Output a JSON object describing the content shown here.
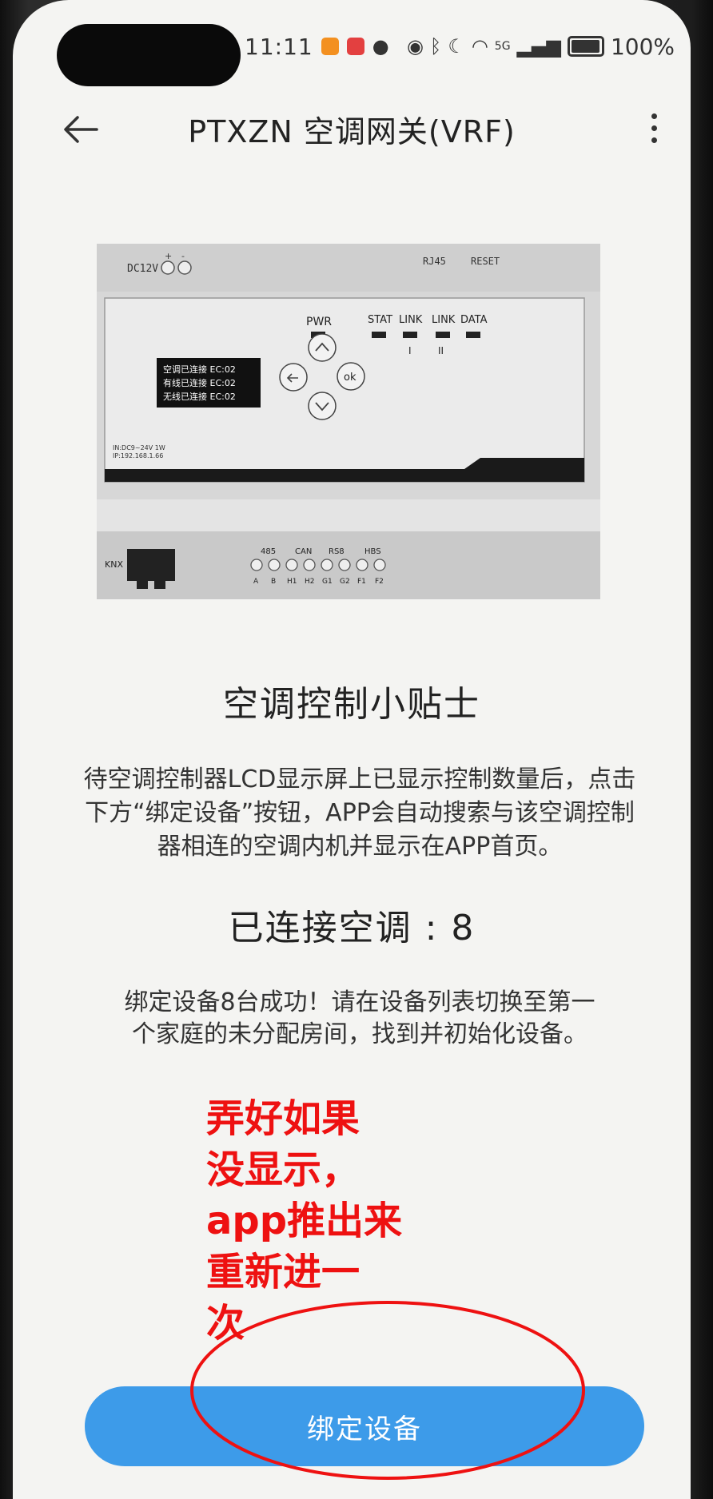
{
  "status_bar": {
    "time": "11:11",
    "battery": "100%",
    "network": "5G"
  },
  "header": {
    "title": "PTXZN 空调网关(VRF)",
    "back_icon": "back-arrow-icon",
    "more_icon": "more-vertical-icon"
  },
  "device": {
    "power_label": "DC12V",
    "plus": "+",
    "minus": "-",
    "rj45": "RJ45",
    "reset": "RESET",
    "leds": [
      "PWR",
      "STAT",
      "LINK",
      "LINK",
      "DATA"
    ],
    "link_1": "I",
    "link_2": "II",
    "lcd_lines": [
      "空调已连接 EC:02",
      "有线已连接 EC:02",
      "无线已连接 EC:02"
    ],
    "ok": "ok",
    "info_line1": "IN:DC9~24V 1W",
    "info_line2": "IP:192.168.1.66",
    "knx": "KNX",
    "terminal_groups": [
      "485",
      "CAN",
      "RS8",
      "HBS"
    ],
    "terminal_labels": [
      "A",
      "B",
      "H1",
      "H2",
      "G1",
      "G2",
      "F1",
      "F2"
    ]
  },
  "tips": {
    "title": "空调控制小贴士",
    "body": "待空调控制器LCD显示屏上已显示控制数量后，点击下方“绑定设备”按钮，APP会自动搜索与该空调控制器相连的空调内机并显示在APP首页。"
  },
  "connected": {
    "text": "已连接空调 : 8"
  },
  "bind_message": "绑定设备8台成功！请在设备列表切换至第一个家庭的未分配房间，找到并初始化设备。",
  "annotation": "弄好如果\n没显示，\napp推出来\n重新进一\n次",
  "bind_button": "绑定设备",
  "colors": {
    "accent": "#3d9be9",
    "annotation": "#ee1111"
  }
}
